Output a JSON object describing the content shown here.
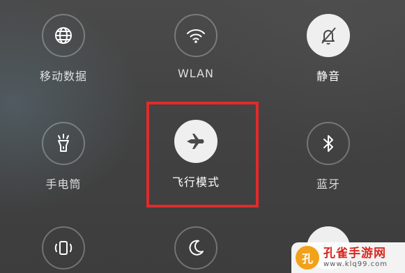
{
  "tiles": {
    "mobile_data": {
      "label": "移动数据",
      "icon": "globe-icon",
      "active": false
    },
    "wlan": {
      "label": "WLAN",
      "icon": "wifi-icon",
      "active": false
    },
    "mute": {
      "label": "静音",
      "icon": "bell-muted-icon",
      "active": true
    },
    "flashlight": {
      "label": "手电筒",
      "icon": "flashlight-icon",
      "active": false
    },
    "airplane": {
      "label": "飞行模式",
      "icon": "airplane-icon",
      "active": true
    },
    "bluetooth": {
      "label": "蓝牙",
      "icon": "bluetooth-icon",
      "active": false
    },
    "rotate": {
      "icon": "rotate-phone-icon",
      "active": false
    },
    "night": {
      "icon": "moon-icon",
      "active": false
    },
    "brightness": {
      "icon": "auto-brightness-icon",
      "active": false
    }
  },
  "watermark": {
    "title": "孔雀手游网",
    "url": "www.klq99.com"
  },
  "colors": {
    "highlight": "#e02b2b",
    "active_circle": "#efefef",
    "watermark_red": "#d8261e"
  }
}
